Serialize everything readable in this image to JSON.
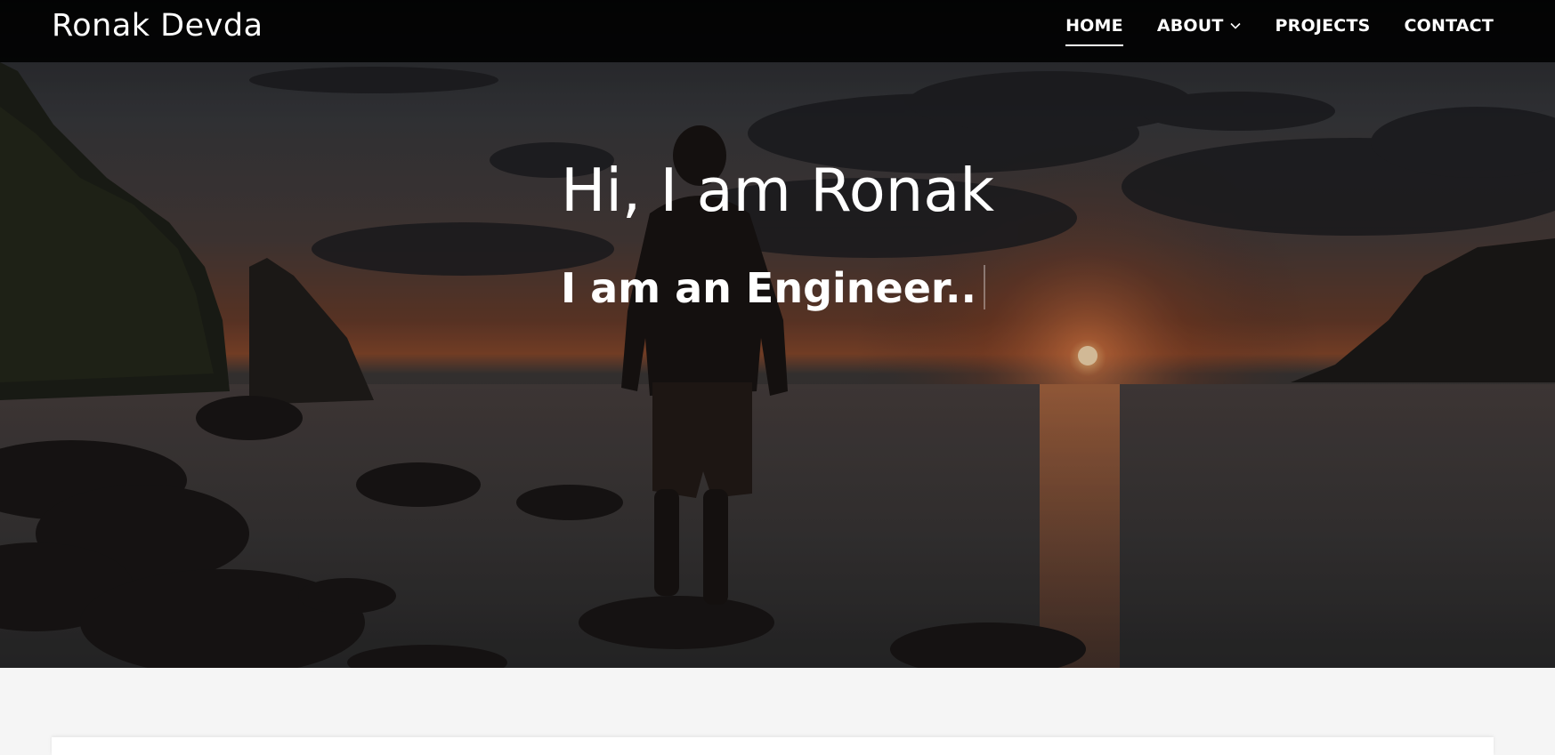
{
  "navbar": {
    "brand": "Ronak Devda",
    "items": [
      {
        "label": "HOME",
        "active": true
      },
      {
        "label": "ABOUT",
        "has_dropdown": true
      },
      {
        "label": "PROJECTS"
      },
      {
        "label": "CONTACT"
      }
    ]
  },
  "hero": {
    "title": "Hi, I am Ronak",
    "subtitle": "I am an Engineer..",
    "background_description_icon": "sunset-beach-photo"
  },
  "colors": {
    "navbar_bg": "#000000",
    "text": "#ffffff",
    "page_bg": "#f5f5f5",
    "sun": "#ffd7a0"
  }
}
